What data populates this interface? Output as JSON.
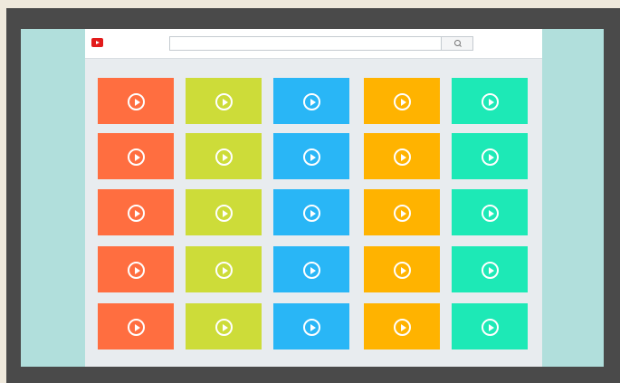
{
  "colors": {
    "frame": "#4a4a4a",
    "screen": "#b1dfdc",
    "brand": "#e21b1b",
    "columns": [
      "#ff6e40",
      "#cddc39",
      "#29b6f6",
      "#ffb300",
      "#1de9b6"
    ]
  },
  "header": {
    "logo_icon": "video-platform-logo-icon",
    "search": {
      "value": "",
      "placeholder": ""
    },
    "search_button_icon": "search-icon"
  },
  "video_grid": {
    "rows": 5,
    "columns": 5,
    "tile_icon": "play-icon"
  }
}
